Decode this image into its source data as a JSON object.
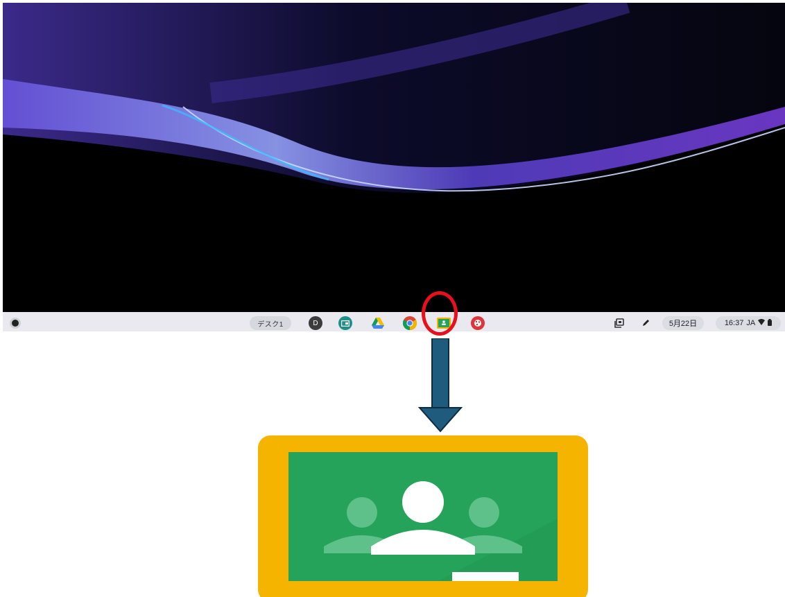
{
  "shelf": {
    "desk_label": "デスク1",
    "avatar_letter": "D",
    "date": "5月22日",
    "time": "16:37",
    "ime": "JA"
  },
  "icons": {
    "launcher": "launcher-icon",
    "apps": [
      "avatar-d-icon",
      "teal-app-icon",
      "google-drive-icon",
      "chrome-icon",
      "google-classroom-icon",
      "red-palette-app-icon"
    ],
    "tray": [
      "screen-capture-icon",
      "stylus-pen-icon",
      "wifi-icon",
      "battery-icon"
    ]
  },
  "colors": {
    "highlight": "#e8101a",
    "arrow": "#1e5b7d",
    "classroom_frame": "#f4b400",
    "classroom_board": "#25a35a"
  }
}
